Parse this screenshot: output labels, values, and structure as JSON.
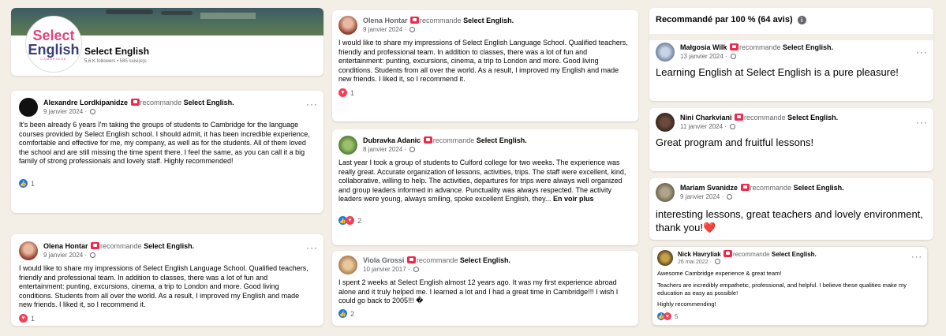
{
  "profile": {
    "logo_line1": "Select",
    "logo_line2": "English",
    "logo_line3": "CAMBRIDGE",
    "name": "Select English",
    "stats": "5,6 K followers • 585 suivi(e)s"
  },
  "summary": {
    "title": "Recommandé par 100 % (64 avis)"
  },
  "recommends_label": "recommande",
  "page_name": "Select English.",
  "reviews": [
    {
      "author": "Alexandre Lordkipanidze",
      "date": "9 janvier 2024",
      "text": "It's been already 6 years I'm taking the groups of students to Cambridge for the language courses provided by Select English school. I should admit, it has been incredible experience, comfortable and effective for me, my company, as well as for the students. All of them loved the school and are still missing the time spent there. I feel the same, as you can call it a big family of strong professionals and lovely staff. Highly recommended!",
      "reactions": "1"
    },
    {
      "author": "Olena Hontar",
      "date": "9 janvier 2024",
      "text": "I would like to share my impressions of Select English Language School. Qualified teachers, friendly and professional team. In addition to classes, there was a lot of fun and entertainment: punting, excursions, cinema, a trip to London and more. Good living conditions. Students from all over the world. As a result, I improved my English and made new friends. I liked it, so I recommend it.",
      "reactions": "1"
    },
    {
      "author": "Olena Hontar",
      "date": "9 janvier 2024",
      "text": "I would like to share my impressions of Select English Language School. Qualified teachers, friendly and professional team. In addition to classes, there was a lot of fun and entertainment: punting, excursions, cinema, a trip to London and more. Good living conditions. Students from all over the world. As a result, I improved my English and made new friends. I liked it, so I recommend it.",
      "reactions": "1"
    },
    {
      "author": "Dubravka Adanic",
      "date": "8 janvier 2024",
      "text": "Last year I took a group of students to Culford college for two weeks. The experience was really great. Accurate organization of lessons, activities, trips. The staff were excellent, kind, collaborative, willing to help.  The activities, departures for trips were always well organized and group leaders informed in advance. Punctuality was always respected. The activity leaders were young, always smiling,  spoke excellent English, they...",
      "more": "En voir plus",
      "reactions": "2"
    },
    {
      "author": "Viola Grossi",
      "date": "10 janvier 2017",
      "text": "I spent 2 weeks at Select English almost 12 years ago. It was my first experience abroad alone and it truly helped me. I learned a lot and I had a great time in Cambridge!!! I wish I could go back to 2005!!! �",
      "reactions": "2"
    },
    {
      "author": "Małgosia Wilk",
      "date": "13 janvier 2024",
      "text": "Learning English at Select English is a pure pleasure!"
    },
    {
      "author": "Nini Charkviani",
      "date": "11 janvier 2024",
      "text": "Great program and fruitful lessons!"
    },
    {
      "author": "Mariam Svanidze",
      "date": "9 janvier 2024",
      "text": "interesting lessons, great teachers and lovely environment, thank you!❤️"
    },
    {
      "author": "Nick Havryliak",
      "date": "26 mai 2022",
      "text_title": "Awesome Cambridge experience & great team!",
      "text": "Teachers are incredibly empathetic, professional, and helpful. I believe these qualities make my education as easy as possible!",
      "text_end": "Highly recommending!",
      "reactions": "5"
    }
  ],
  "colors": {
    "background": "#f3eee6",
    "like": "#1877f2",
    "love": "#f33e58",
    "recommend": "#f02849",
    "brand_pink": "#e0457b"
  }
}
